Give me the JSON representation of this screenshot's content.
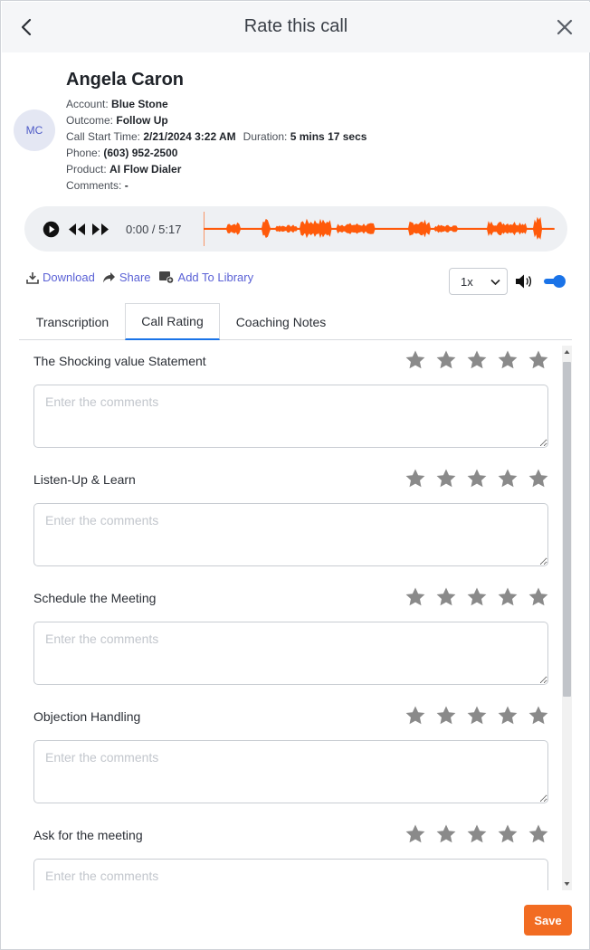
{
  "header": {
    "title": "Rate this call",
    "back_icon": "chevron-left-icon",
    "close_icon": "close-icon"
  },
  "contact": {
    "avatar_initials": "MC",
    "name": "Angela Caron",
    "account_label": "Account:",
    "account": "Blue Stone",
    "outcome_label": "Outcome:",
    "outcome": "Follow Up",
    "start_label": "Call Start Time:",
    "start": "2/21/2024 3:22 AM",
    "duration_label": "Duration:",
    "duration": "5 mins 17 secs",
    "phone_label": "Phone:",
    "phone": "(603) 952-2500",
    "product_label": "Product:",
    "product": "AI Flow Dialer",
    "comments_label": "Comments:",
    "comments": "-"
  },
  "player": {
    "current": "0:00 /",
    "total": "5:17",
    "wave_color": "#ff5a0a"
  },
  "actions": {
    "download": "Download",
    "share": "Share",
    "add_library": "Add To Library"
  },
  "speed": {
    "selected": "1x"
  },
  "tabs": [
    {
      "label": "Transcription"
    },
    {
      "label": "Call Rating"
    },
    {
      "label": "Coaching Notes"
    }
  ],
  "active_tab": "Call Rating",
  "criteria": [
    {
      "label": "The Shocking value Statement",
      "placeholder": "Enter the comments",
      "rating": 0
    },
    {
      "label": "Listen-Up & Learn",
      "placeholder": "Enter the comments",
      "rating": 0
    },
    {
      "label": "Schedule the Meeting",
      "placeholder": "Enter the comments",
      "rating": 0
    },
    {
      "label": "Objection Handling",
      "placeholder": "Enter the comments",
      "rating": 0
    },
    {
      "label": "Ask for the meeting",
      "placeholder": "Enter the comments",
      "rating": 0
    }
  ],
  "save_label": "Save",
  "colors": {
    "accent": "#1a73e8",
    "save": "#f26c22",
    "link": "#5b62d6",
    "star": "#8a8a8a"
  }
}
